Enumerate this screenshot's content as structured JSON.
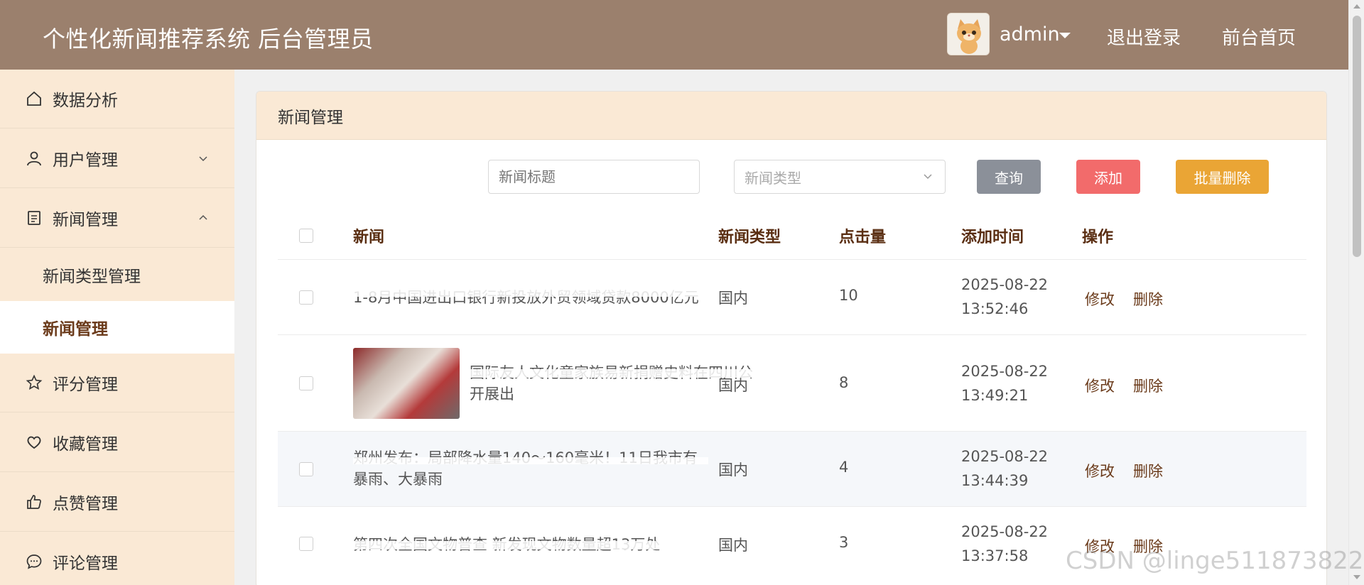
{
  "header": {
    "title": "个性化新闻推荐系统 后台管理员",
    "username": "admin",
    "logout": "退出登录",
    "home": "前台首页"
  },
  "sidebar": {
    "items": [
      {
        "label": "数据分析",
        "icon": "home-icon"
      },
      {
        "label": "用户管理",
        "icon": "user-icon"
      },
      {
        "label": "新闻管理",
        "icon": "document-icon"
      },
      {
        "label": "评分管理",
        "icon": "star-icon"
      },
      {
        "label": "收藏管理",
        "icon": "heart-icon"
      },
      {
        "label": "点赞管理",
        "icon": "thumbs-up-icon"
      },
      {
        "label": "评论管理",
        "icon": "comment-icon"
      }
    ],
    "sub_items": [
      {
        "label": "新闻类型管理"
      },
      {
        "label": "新闻管理"
      }
    ]
  },
  "main": {
    "card_title": "新闻管理",
    "search_placeholder": "新闻标题",
    "type_placeholder": "新闻类型",
    "buttons": {
      "query": "查询",
      "add": "添加",
      "batch_delete": "批量删除"
    },
    "columns": [
      "新闻",
      "新闻类型",
      "点击量",
      "添加时间",
      "操作"
    ],
    "rows": [
      {
        "title": "1-8月中国进出口银行新投放外贸领域贷款8000亿元",
        "type": "国内",
        "clicks": "10",
        "date": "2025-08-22",
        "time": "13:52:46",
        "edit": "修改",
        "delete": "删除"
      },
      {
        "title": "国际友人文化童家族易新捐赠史料在四川公开展出",
        "type": "国内",
        "clicks": "8",
        "date": "2025-08-22",
        "time": "13:49:21",
        "edit": "修改",
        "delete": "删除"
      },
      {
        "title": "郑州发布：局部降水量140～160毫米！11日我市有暴雨、大暴雨",
        "type": "国内",
        "clicks": "4",
        "date": "2025-08-22",
        "time": "13:44:39",
        "edit": "修改",
        "delete": "删除"
      },
      {
        "title": "第四次全国文物普查 新发现文物数量超13万处",
        "type": "国内",
        "clicks": "3",
        "date": "2025-08-22",
        "time": "13:37:58",
        "edit": "修改",
        "delete": "删除"
      }
    ]
  },
  "watermark": "CSDN @linge511873822",
  "colors": {
    "header": "#9b806d",
    "sidebar": "#fae9d5",
    "accent": "#6b3b1b"
  }
}
